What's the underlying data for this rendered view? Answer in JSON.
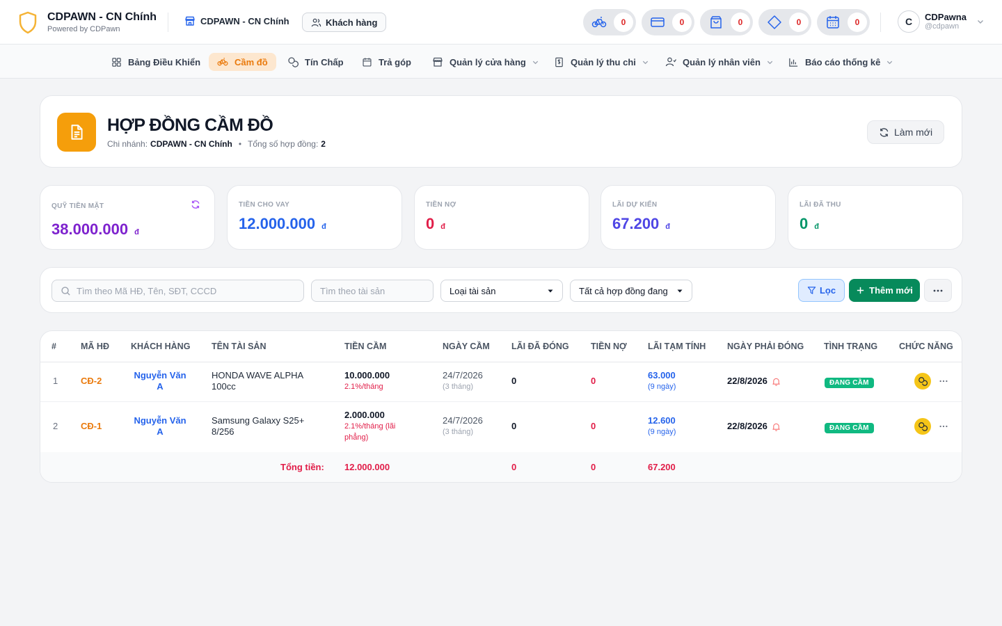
{
  "brand": {
    "title": "CDPAWN - CN Chính",
    "subtitle": "Powered by CDPawn"
  },
  "topbar": {
    "branch": "CDPAWN - CN Chính",
    "customers_button": "Khách hàng",
    "counters": [
      {
        "icon": "bicycle-icon",
        "count": "0"
      },
      {
        "icon": "credit-card-icon",
        "count": "0"
      },
      {
        "icon": "shopping-bag-icon",
        "count": "0"
      },
      {
        "icon": "diamond-icon",
        "count": "0"
      },
      {
        "icon": "calendar-icon",
        "count": "0"
      }
    ],
    "user": {
      "initial": "C",
      "name": "CDPawna",
      "handle": "@cdpawn"
    }
  },
  "nav": [
    {
      "label": "Bảng Điều Khiển",
      "icon": "dashboard-icon"
    },
    {
      "label": "Cầm đồ",
      "icon": "bicycle-icon",
      "active": true
    },
    {
      "label": "Tín Chấp",
      "icon": "coins-icon"
    },
    {
      "label": "Trả góp",
      "icon": "calendar-icon"
    },
    {
      "label": "Quản lý cửa hàng",
      "icon": "store-icon",
      "dropdown": true
    },
    {
      "label": "Quản lý thu chi",
      "icon": "receipt-icon",
      "dropdown": true
    },
    {
      "label": "Quản lý nhân viên",
      "icon": "user-icon",
      "dropdown": true
    },
    {
      "label": "Báo cáo thống kê",
      "icon": "bar-chart-icon",
      "dropdown": true
    }
  ],
  "header": {
    "title": "HỢP ĐỒNG CẦM ĐỒ",
    "branch_label": "Chi nhánh:",
    "branch_value": "CDPAWN - CN Chính",
    "total_label": "Tổng số hợp đồng:",
    "total_value": "2",
    "refresh_button": "Làm mới"
  },
  "stats": [
    {
      "label": "Quỹ tiền mặt",
      "value": "38.000.000",
      "currency": "đ",
      "color": "#7e22ce"
    },
    {
      "label": "Tiền cho vay",
      "value": "12.000.000",
      "currency": "đ",
      "color": "#2563eb"
    },
    {
      "label": "Tiền nợ",
      "value": "0",
      "currency": "đ",
      "color": "#e11d48"
    },
    {
      "label": "Lãi dự kiến",
      "value": "67.200",
      "currency": "đ",
      "color": "#4f46e5"
    },
    {
      "label": "Lãi đã thu",
      "value": "0",
      "currency": "đ",
      "color": "#059669"
    }
  ],
  "filters": {
    "search_placeholder": "Tìm theo Mã HĐ, Tên, SĐT, CCCD",
    "asset_search_placeholder": "Tìm theo tài sản",
    "asset_type": "Loại tài sản",
    "status": "Tất cả hợp đồng đang",
    "filter_button": "Lọc",
    "add_button": "Thêm mới"
  },
  "table": {
    "columns": [
      "#",
      "Mã HĐ",
      "Khách hàng",
      "Tên tài sản",
      "Tiền cầm",
      "Ngày cầm",
      "Lãi đã đóng",
      "Tiền nợ",
      "Lãi tạm tính",
      "Ngày phải đóng",
      "Tình trạng",
      "Chức năng"
    ],
    "rows": [
      {
        "index": "1",
        "code": "CĐ-2",
        "customer": "Nguyễn Văn A",
        "asset": "HONDA WAVE ALPHA 100cc",
        "amount": "10.000.000",
        "rate": "2.1%/tháng",
        "date": "24/7/2026",
        "duration": "(3 tháng)",
        "interest_paid": "0",
        "debt": "0",
        "interest_est": "63.000",
        "interest_days": "(9 ngày)",
        "due_date": "22/8/2026",
        "status": "ĐANG CẦM"
      },
      {
        "index": "2",
        "code": "CĐ-1",
        "customer": "Nguyễn Văn A",
        "asset": "Samsung Galaxy S25+ 8/256",
        "amount": "2.000.000",
        "rate": "2.1%/tháng (lãi phẳng)",
        "date": "24/7/2026",
        "duration": "(3 tháng)",
        "interest_paid": "0",
        "debt": "0",
        "interest_est": "12.600",
        "interest_days": "(9 ngày)",
        "due_date": "22/8/2026",
        "status": "ĐANG CẦM"
      }
    ],
    "totals": {
      "label": "Tổng tiền:",
      "amount": "12.000.000",
      "interest_paid": "0",
      "debt": "0",
      "interest_est": "67.200"
    }
  }
}
